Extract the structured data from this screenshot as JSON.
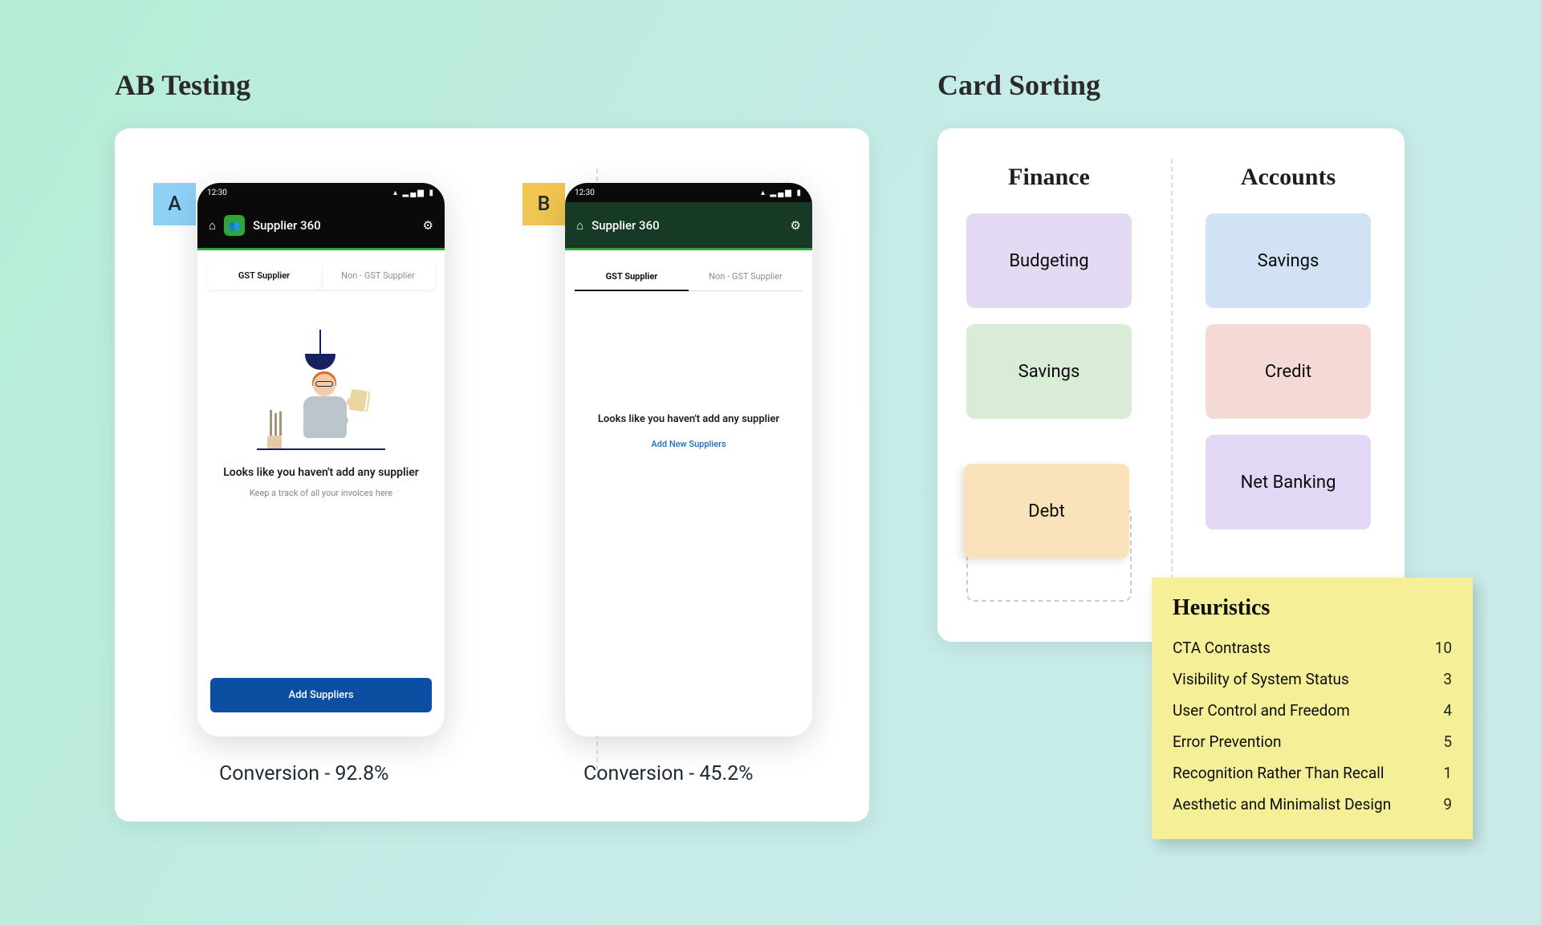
{
  "ab": {
    "title": "AB Testing",
    "badge_a": "A",
    "badge_b": "B",
    "statusbar_time": "12:30",
    "app_title": "Supplier 360",
    "tab_gst": "GST Supplier",
    "tab_non": "Non - GST Supplier",
    "empty_a": {
      "title": "Looks like you haven't add any supplier",
      "subtitle": "Keep a track of all your invoices here",
      "button": "Add Suppliers"
    },
    "empty_b": {
      "title": "Looks like you haven't add any supplier",
      "link": "Add New Suppliers"
    },
    "conversion_a": "Conversion - 92.8%",
    "conversion_b": "Conversion - 45.2%"
  },
  "card_sorting": {
    "title": "Card Sorting",
    "column_finance": "Finance",
    "column_accounts": "Accounts",
    "finance_cards": [
      "Budgeting",
      "Savings",
      "Debt"
    ],
    "accounts_cards": [
      "Savings",
      "Credit",
      "Net Banking"
    ]
  },
  "heuristics": {
    "title": "Heuristics",
    "rows": [
      {
        "label": "CTA Contrasts",
        "value": "10"
      },
      {
        "label": "Visibility of System Status",
        "value": "3"
      },
      {
        "label": "User Control and Freedom",
        "value": "4"
      },
      {
        "label": "Error Prevention",
        "value": "5"
      },
      {
        "label": "Recognition Rather Than Recall",
        "value": "1"
      },
      {
        "label": "Aesthetic and Minimalist Design",
        "value": "9"
      }
    ]
  }
}
